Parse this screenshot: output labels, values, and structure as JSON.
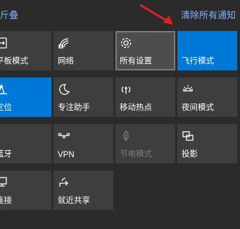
{
  "header": {
    "collapse_label": "折叠",
    "collapse_visible": "斤叠",
    "clear_label": "清除所有通知"
  },
  "tiles": [
    {
      "label": "平板模式",
      "visible_label": "平板模式",
      "icon": "tablet-mode-icon",
      "state": "normal"
    },
    {
      "label": "网络",
      "icon": "network-icon",
      "state": "normal"
    },
    {
      "label": "所有设置",
      "icon": "gear-icon",
      "state": "hover"
    },
    {
      "label": "飞行模式",
      "icon": "airplane-icon",
      "state": "active"
    },
    {
      "label": "定位",
      "icon": "location-icon",
      "state": "active"
    },
    {
      "label": "专注助手",
      "icon": "moon-icon",
      "state": "normal"
    },
    {
      "label": "移动热点",
      "icon": "hotspot-icon",
      "state": "normal"
    },
    {
      "label": "夜间模式",
      "icon": "brightness-icon",
      "state": "normal"
    },
    {
      "label": "蓝牙",
      "icon": "bluetooth-icon",
      "state": "normal"
    },
    {
      "label": "VPN",
      "icon": "vpn-icon",
      "state": "normal"
    },
    {
      "label": "节电模式",
      "icon": "battery-saver-icon",
      "state": "disabled"
    },
    {
      "label": "投影",
      "icon": "project-icon",
      "state": "normal"
    },
    {
      "label": "连接",
      "icon": "connect-icon",
      "state": "normal"
    },
    {
      "label": "就近共享",
      "icon": "nearby-share-icon",
      "state": "normal"
    }
  ],
  "colors": {
    "background": "#2b2b2b",
    "tile": "#3e3e3e",
    "tile_active": "#0078d7",
    "link": "#7fb3ff",
    "arrow": "#e02020"
  }
}
